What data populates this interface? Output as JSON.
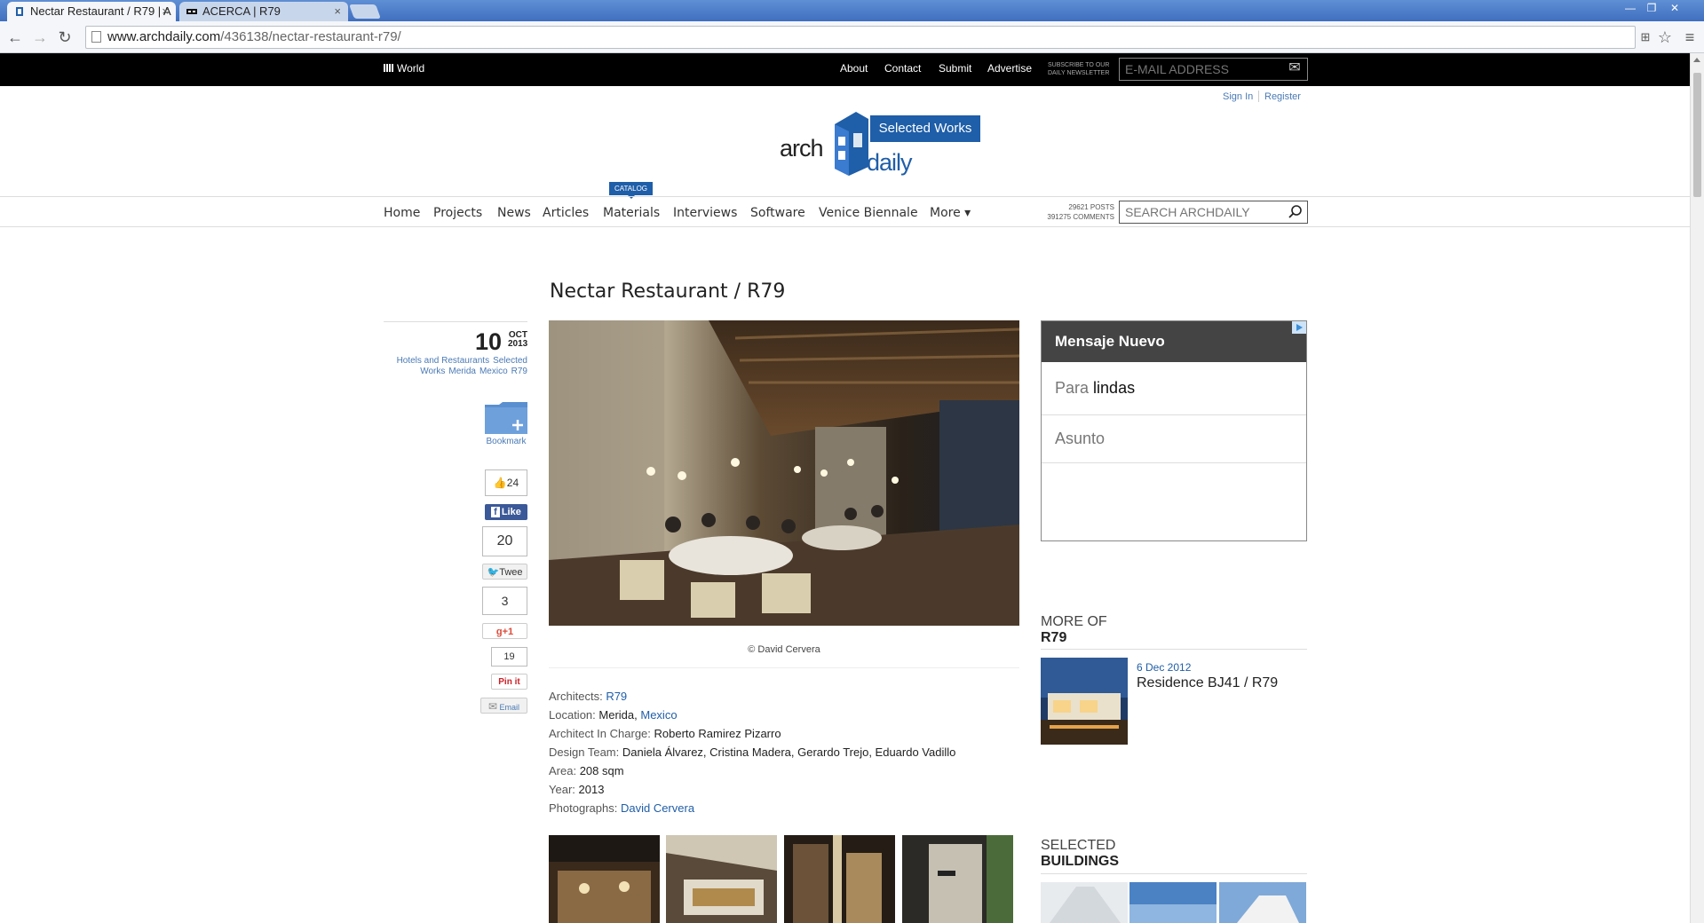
{
  "browser": {
    "tabs": [
      {
        "title": "Nectar Restaurant / R79 | A",
        "active": true
      },
      {
        "title": "ACERCA | R79",
        "active": false
      }
    ],
    "close_glyph": "×",
    "url_host": "www.archdaily.com",
    "url_path": "/436138/nectar-restaurant-r79/"
  },
  "site": {
    "world_label": "World",
    "top_links": [
      "About",
      "Contact",
      "Submit",
      "Advertise"
    ],
    "newsletter_label_1": "SUBSCRIBE TO OUR",
    "newsletter_label_2": "DAILY NEWSLETTER",
    "email_placeholder": "E-MAIL ADDRESS",
    "sign_in": "Sign In",
    "register": "Register",
    "logo_arch": "arch",
    "logo_daily": "daily",
    "logo_badge": "Selected Works",
    "catalog_badge": "CATALOG",
    "nav": [
      "Home",
      "Projects",
      "News",
      "Articles",
      "Materials",
      "Interviews",
      "Software",
      "Venice Biennale",
      "More ▾"
    ],
    "posts_count": "29621 POSTS",
    "comments_count": "391275 COMMENTS",
    "search_placeholder": "SEARCH ARCHDAILY"
  },
  "article": {
    "title": "Nectar Restaurant / R79",
    "day": "10",
    "month": "OCT",
    "year": "2013",
    "tags_line1": [
      "Hotels and Restaurants",
      "Selected"
    ],
    "tags_line2": [
      "Works",
      "Merida",
      "Mexico",
      "R79"
    ],
    "bookmark_label": "Bookmark",
    "social": {
      "fb_count": "24",
      "fb_label": "Like",
      "tw_count": "20",
      "tw_label": "Twee",
      "gp_count": "3",
      "gp_label": "g+1",
      "pin_count": "19",
      "pin_label": "Pin it",
      "email_label": "Email"
    },
    "photo_credit": "© David Cervera",
    "specs": {
      "architects_label": "Architects:",
      "architects": "R79",
      "location_label": "Location:",
      "location_city": "Merida,",
      "location_country": "Mexico",
      "architect_in_charge_label": "Architect In Charge:",
      "architect_in_charge": "Roberto Ramirez Pizarro",
      "design_team_label": "Design Team:",
      "design_team": "Daniela Álvarez, Cristina Madera, Gerardo Trejo, Eduardo Vadillo",
      "area_label": "Area:",
      "area": "208 sqm",
      "year_label": "Year:",
      "year": "2013",
      "photographs_label": "Photographs:",
      "photographs": "David Cervera"
    }
  },
  "sidebar": {
    "ad_header": "Mensaje Nuevo",
    "ad_to_label": "Para",
    "ad_to_value": "lindas",
    "ad_subject": "Asunto",
    "more_of_1": "MORE OF",
    "more_of_2": "R79",
    "related_date": "6 Dec 2012",
    "related_title": "Residence BJ41 / R79",
    "selected_1": "SELECTED",
    "selected_2": "BUILDINGS"
  },
  "colors": {
    "accent": "#1f5ea8",
    "link": "#4a7ab5"
  }
}
